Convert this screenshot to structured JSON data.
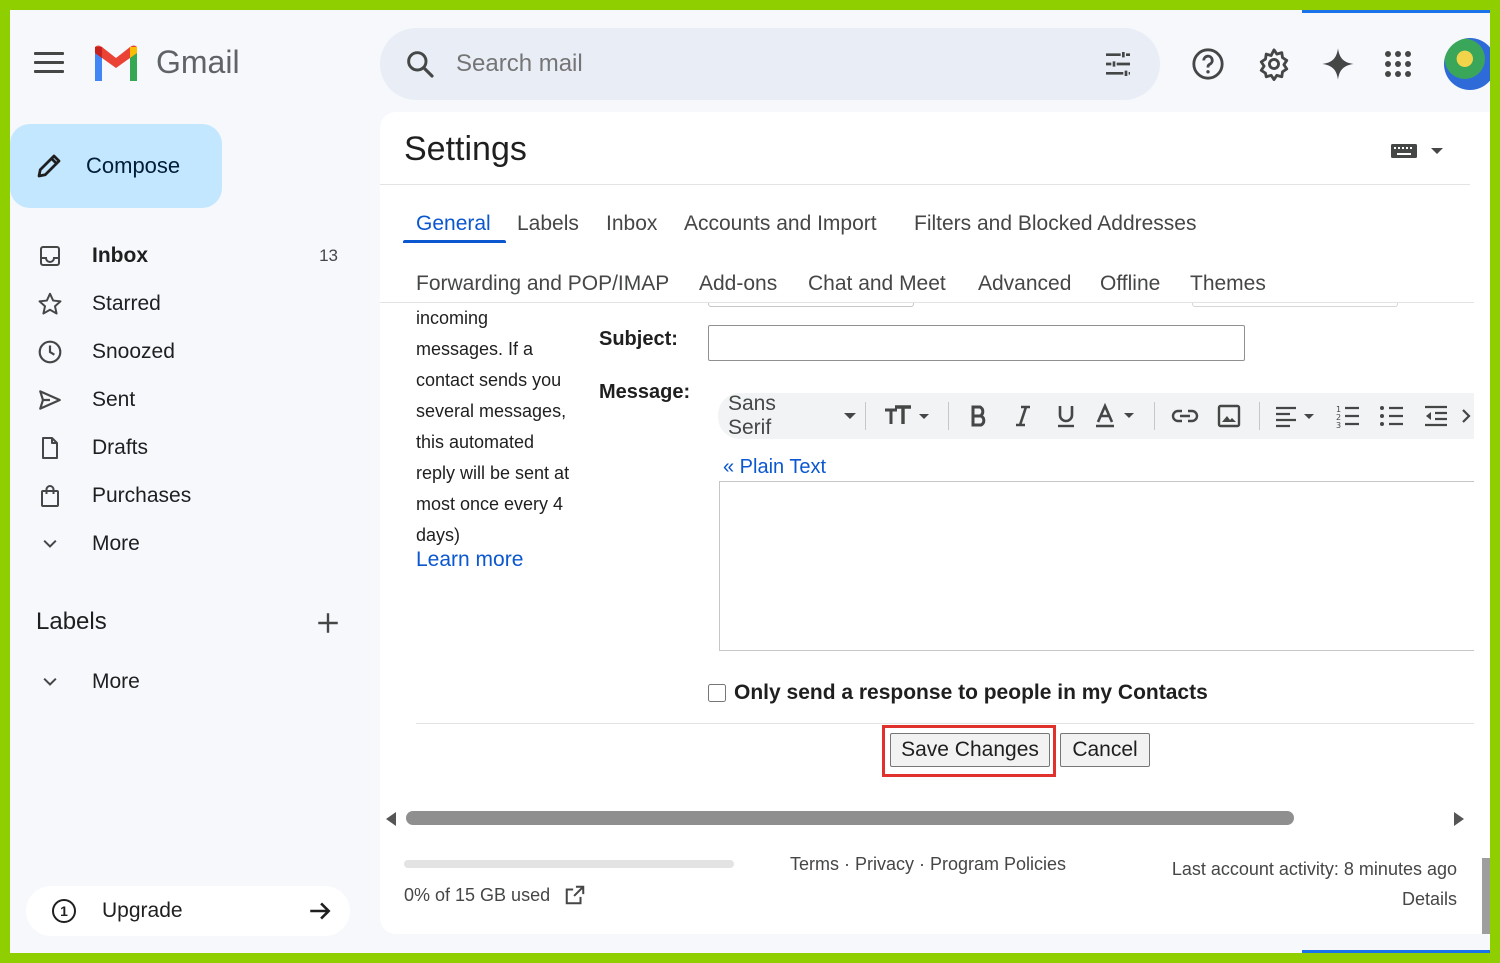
{
  "header": {
    "app_name": "Gmail",
    "search_placeholder": "Search mail"
  },
  "sidebar": {
    "compose_label": "Compose",
    "items": [
      {
        "label": "Inbox",
        "count": "13"
      },
      {
        "label": "Starred"
      },
      {
        "label": "Snoozed"
      },
      {
        "label": "Sent"
      },
      {
        "label": "Drafts"
      },
      {
        "label": "Purchases"
      },
      {
        "label": "More"
      }
    ],
    "labels_heading": "Labels",
    "labels_more": "More",
    "upgrade_number": "1",
    "upgrade_label": "Upgrade"
  },
  "settings": {
    "title": "Settings",
    "tabs_row1": [
      "General",
      "Labels",
      "Inbox",
      "Accounts and Import",
      "Filters and Blocked Addresses"
    ],
    "tabs_row2": [
      "Forwarding and POP/IMAP",
      "Add-ons",
      "Chat and Meet",
      "Advanced",
      "Offline",
      "Themes"
    ],
    "active_tab": "General",
    "description_lines": [
      "incoming",
      "messages. If a",
      "contact sends you",
      "several messages,",
      "this automated",
      "reply will be sent at",
      "most once every 4",
      "days)"
    ],
    "learn_more": "Learn more",
    "subject_label": "Subject:",
    "subject_value": "",
    "message_label": "Message:",
    "font_name": "Sans Serif",
    "plain_text_link": "« Plain Text",
    "only_contacts_label": "Only send a response to people in my Contacts",
    "only_contacts_checked": false,
    "save_label": "Save Changes",
    "cancel_label": "Cancel"
  },
  "footer": {
    "storage_text": "0% of 15 GB used",
    "storage_fraction": 0.0,
    "links": [
      "Terms",
      "Privacy",
      "Program Policies"
    ],
    "separator": " · ",
    "last_activity": "Last account activity: 8 minutes ago",
    "details": "Details"
  },
  "colors": {
    "accent": "#0b57d0",
    "compose_bg": "#c2e7ff",
    "highlight_box": "#e0312c",
    "outer_frame": "#8fcf00"
  }
}
